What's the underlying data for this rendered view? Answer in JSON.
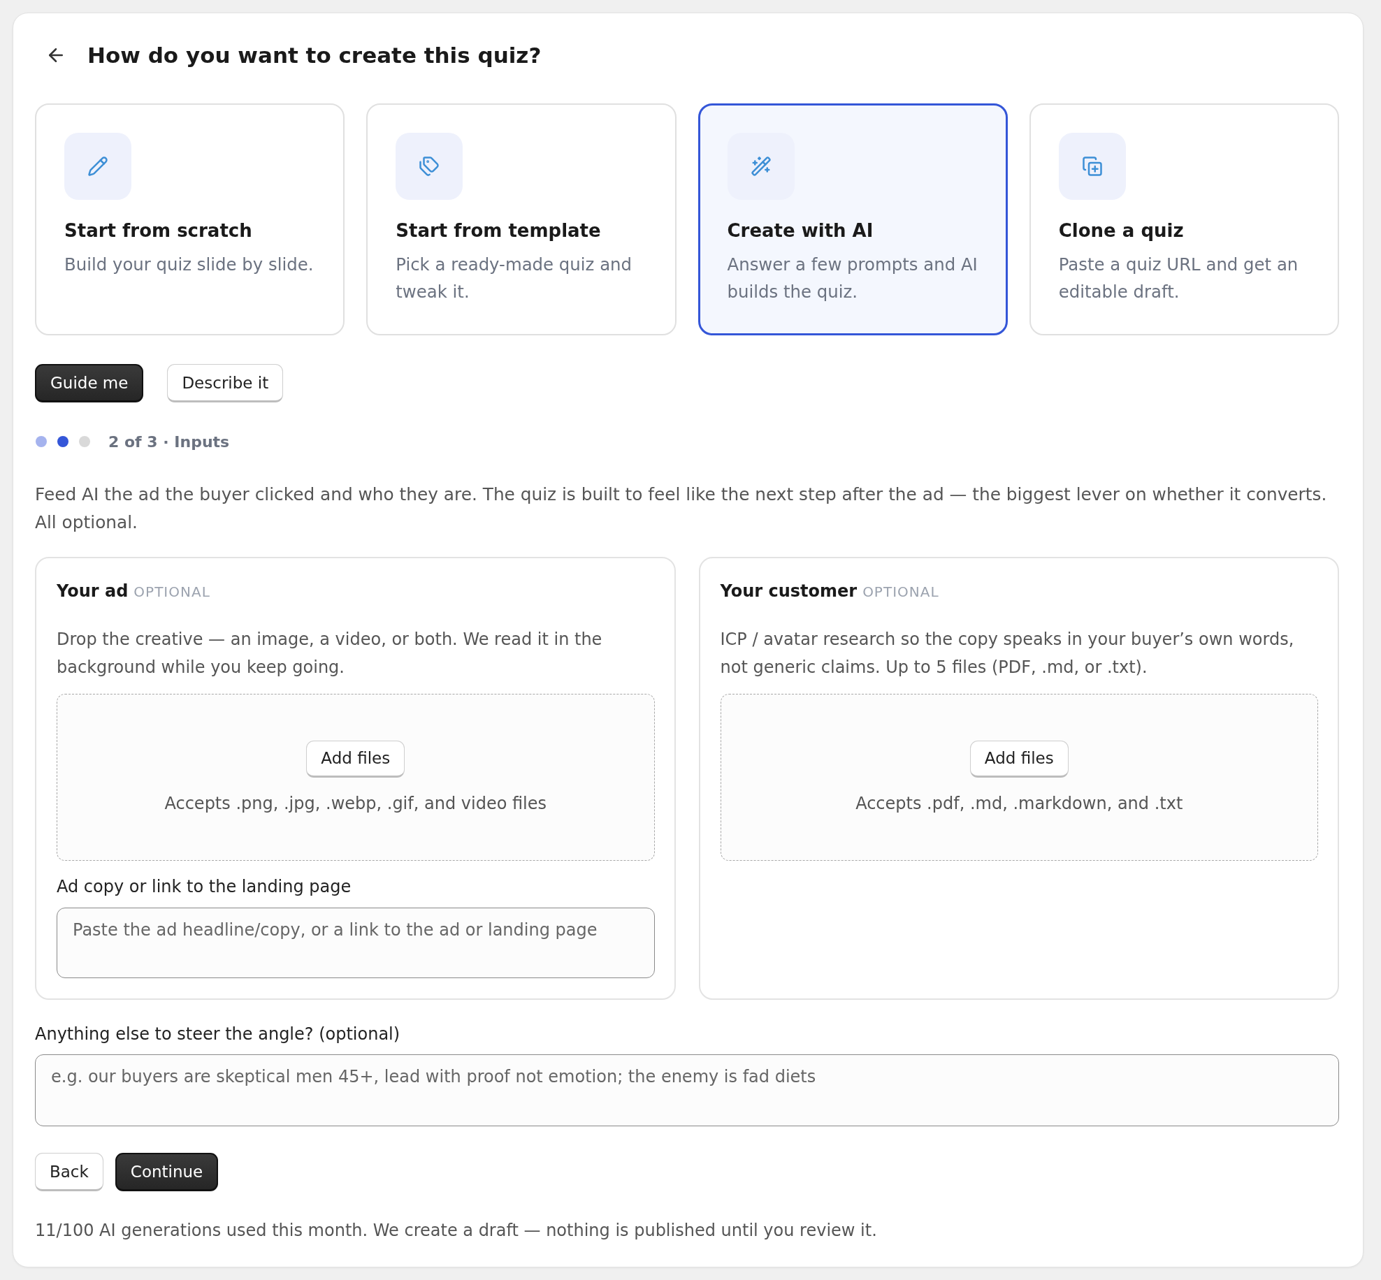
{
  "header": {
    "title": "How do you want to create this quiz?"
  },
  "options": [
    {
      "kind": "scratch",
      "title": "Start from scratch",
      "description": "Build your quiz slide by slide.",
      "selected": false
    },
    {
      "kind": "template",
      "title": "Start from template",
      "description": "Pick a ready-made quiz and tweak it.",
      "selected": false
    },
    {
      "kind": "ai",
      "title": "Create with AI",
      "description": "Answer a few prompts and AI builds the quiz.",
      "selected": true
    },
    {
      "kind": "clone",
      "title": "Clone a quiz",
      "description": "Paste a quiz URL and get an editable draft.",
      "selected": false
    }
  ],
  "modes": [
    {
      "label": "Guide me",
      "selected": true
    },
    {
      "label": "Describe it",
      "selected": false
    }
  ],
  "progress": {
    "steps": [
      {
        "selected": false
      },
      {
        "selected": true
      },
      {
        "selected": false
      }
    ],
    "label": "2 of 3 · Inputs"
  },
  "intro": "Feed AI the ad the buyer clicked and who they are. The quiz is built to feel like the next step after the ad — the biggest lever on whether it converts. All optional.",
  "panels": [
    {
      "title": "Your ad",
      "badge": "OPTIONAL",
      "description": "Drop the creative — an image, a video, or both. We read it in the background while you keep going.",
      "dropzone": {
        "button": "Add files",
        "hint": "Accepts .png, .jpg, .webp, .gif, and video files"
      },
      "field": {
        "label": "Ad copy or link to the landing page",
        "placeholder": "Paste the ad headline/copy, or a link to the ad or landing page"
      }
    },
    {
      "title": "Your customer",
      "badge": "OPTIONAL",
      "description": "ICP / avatar research so the copy speaks in your buyer’s own words, not generic claims. Up to 5 files (PDF, .md, or .txt).",
      "dropzone": {
        "button": "Add files",
        "hint": "Accepts .pdf, .md, .markdown, and .txt"
      }
    }
  ],
  "steer": {
    "label": "Anything else to steer the angle? (optional)",
    "placeholder": "e.g. our buyers are skeptical men 45+, lead with proof not emotion; the enemy is fad diets"
  },
  "actions": [
    {
      "label": "Back",
      "kind": "secondary"
    },
    {
      "label": "Continue",
      "kind": "primary"
    }
  ],
  "footer": "11/100 AI generations used this month. We create a draft — nothing is published until you review it."
}
